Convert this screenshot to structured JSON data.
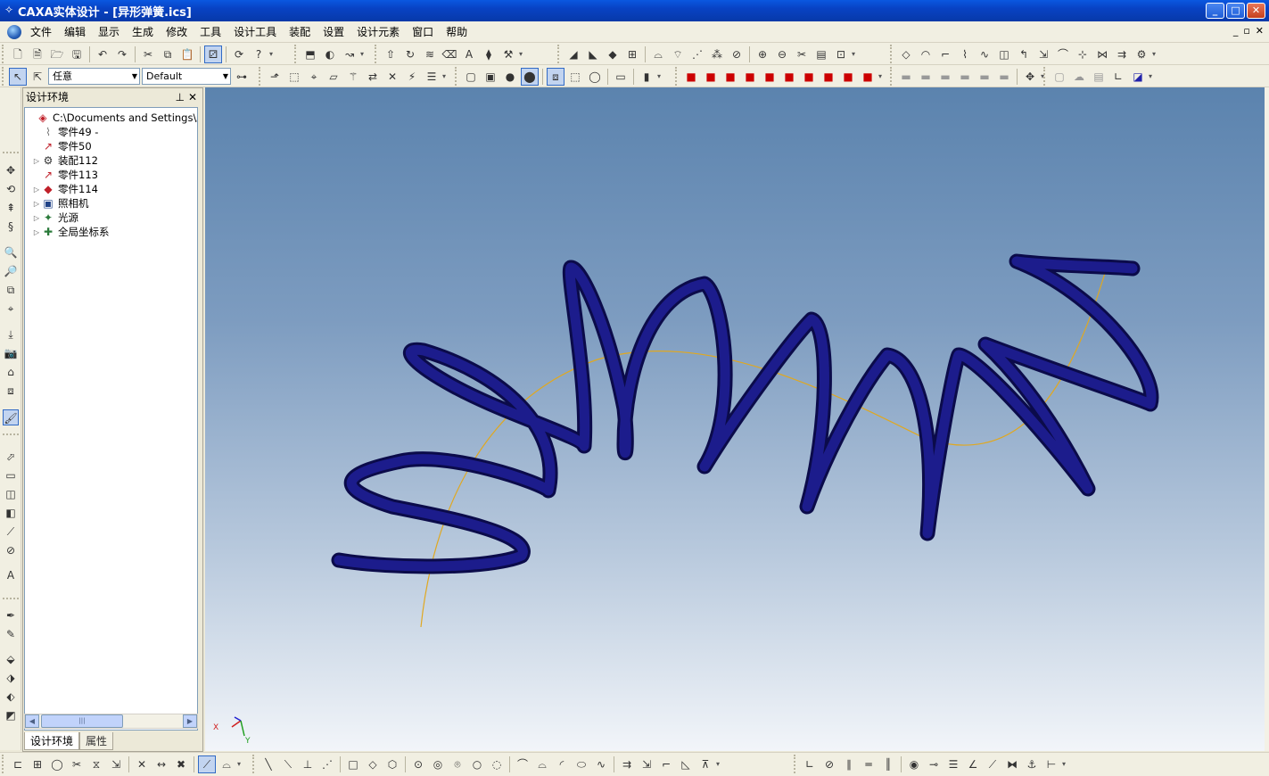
{
  "window": {
    "title": "CAXA实体设计 - [异形弹簧.ics]",
    "buttons": [
      "_",
      "□",
      "✕"
    ]
  },
  "menubar": {
    "items": [
      "文件",
      "编辑",
      "显示",
      "生成",
      "修改",
      "工具",
      "设计工具",
      "装配",
      "设置",
      "设计元素",
      "窗口",
      "帮助"
    ],
    "mdi_buttons": [
      "_",
      "▫",
      "✕"
    ]
  },
  "toolbar2": {
    "selection_filter": "任意",
    "style_combo": "Default"
  },
  "panel": {
    "title": "设计环境",
    "tree": [
      {
        "label": "C:\\Documents and Settings\\Admini",
        "icon": "scene-root-icon",
        "glyph": "◈",
        "color": "#c0202a",
        "depth": 0,
        "expander": ""
      },
      {
        "label": "零件49 -",
        "icon": "part-icon",
        "glyph": "⌇",
        "color": "#777777",
        "depth": 1,
        "expander": ""
      },
      {
        "label": "零件50",
        "icon": "part-curve-icon",
        "glyph": "↗",
        "color": "#c0202a",
        "depth": 1,
        "expander": ""
      },
      {
        "label": "装配112",
        "icon": "assembly-icon",
        "glyph": "⚙",
        "color": "#333333",
        "depth": 1,
        "expander": "▷"
      },
      {
        "label": "零件113",
        "icon": "part-curve-icon",
        "glyph": "↗",
        "color": "#c0202a",
        "depth": 1,
        "expander": ""
      },
      {
        "label": "零件114",
        "icon": "solid-part-icon",
        "glyph": "◆",
        "color": "#c0202a",
        "depth": 1,
        "expander": "▷"
      },
      {
        "label": "照相机",
        "icon": "camera-icon",
        "glyph": "▣",
        "color": "#224488",
        "depth": 1,
        "expander": "▷"
      },
      {
        "label": "光源",
        "icon": "light-icon",
        "glyph": "✦",
        "color": "#2a7a3a",
        "depth": 1,
        "expander": "▷"
      },
      {
        "label": "全局坐标系",
        "icon": "global-axes-icon",
        "glyph": "✚",
        "color": "#2a7a3a",
        "depth": 1,
        "expander": "▷"
      }
    ],
    "tabs": [
      "设计环境",
      "属性"
    ]
  },
  "viewport": {
    "axis_labels": {
      "x": "X",
      "y": "Y"
    },
    "spring_color": "#1c1c8c",
    "path_color": "#e0a820"
  }
}
